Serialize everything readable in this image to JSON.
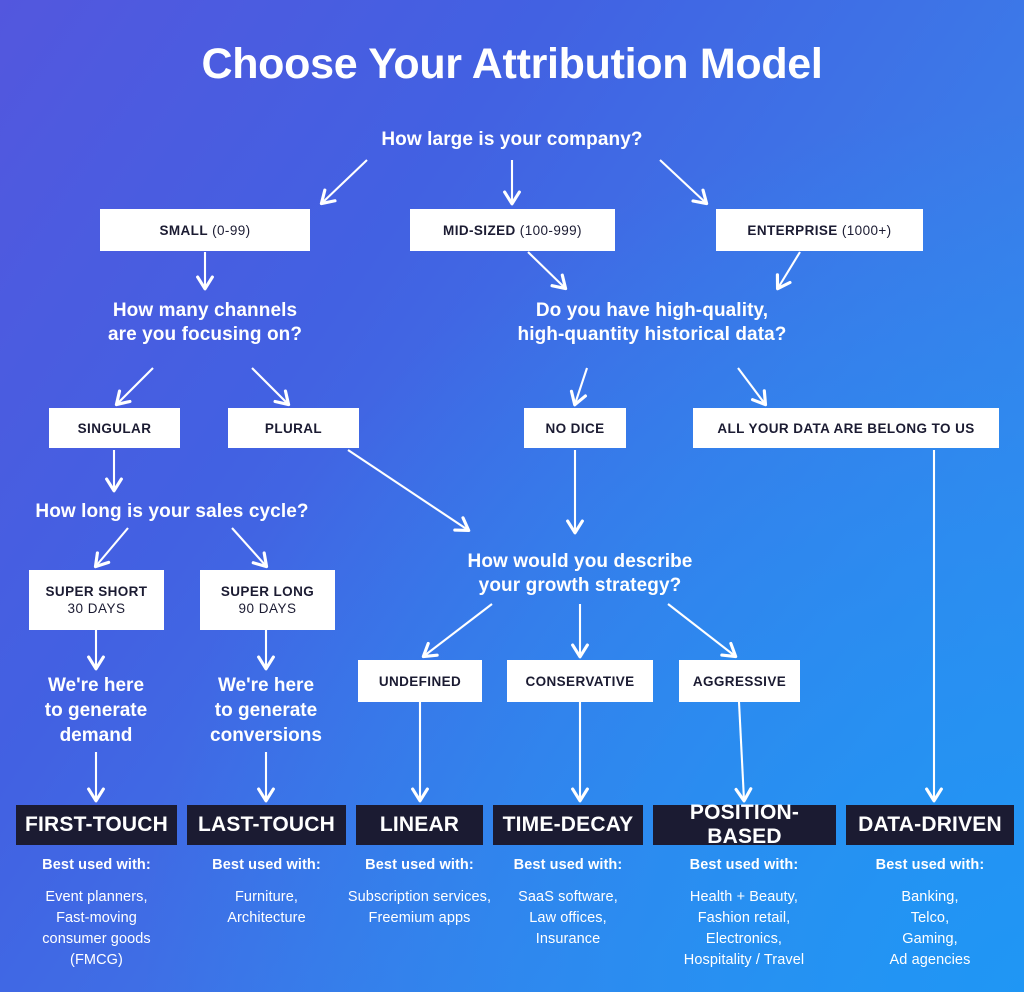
{
  "title": "Choose Your Attribution Model",
  "colors": {
    "bg_start": "#5357de",
    "bg_end": "#3391ef",
    "box_fill": "#ffffff",
    "box_text": "#1b1b32",
    "model_box_fill": "#1b1b32",
    "text_on_bg": "#ffffff"
  },
  "questions": {
    "q_company_size": "How large is your company?",
    "q_channels_line1": "How many channels",
    "q_channels_line2": "are you focusing on?",
    "q_data_line1": "Do you have high-quality,",
    "q_data_line2": "high-quantity historical data?",
    "q_sales_cycle": "How long is your sales cycle?",
    "q_growth_line1": "How would you describe",
    "q_growth_line2": "your growth strategy?"
  },
  "size_boxes": [
    {
      "bold": "SMALL",
      "rest": " (0-99)"
    },
    {
      "bold": "MID-SIZED",
      "rest": " (100-999)"
    },
    {
      "bold": "ENTERPRISE",
      "rest": " (1000+)"
    }
  ],
  "channel_boxes": [
    {
      "bold": "SINGULAR",
      "rest": ""
    },
    {
      "bold": "PLURAL",
      "rest": ""
    }
  ],
  "data_boxes": [
    {
      "bold": "NO DICE",
      "rest": ""
    },
    {
      "bold": "ALL YOUR DATA ARE BELONG TO US",
      "rest": ""
    }
  ],
  "cycle_boxes": [
    {
      "bold": "SUPER SHORT",
      "line2": "30 DAYS"
    },
    {
      "bold": "SUPER LONG",
      "line2": "90 DAYS"
    }
  ],
  "outcomes": [
    {
      "line1": "We're here",
      "line2": "to generate",
      "line3": "demand"
    },
    {
      "line1": "We're here",
      "line2": "to generate",
      "line3": "conversions"
    }
  ],
  "growth_boxes": [
    {
      "bold": "UNDEFINED",
      "rest": ""
    },
    {
      "bold": "CONSERVATIVE",
      "rest": ""
    },
    {
      "bold": "AGGRESSIVE",
      "rest": ""
    }
  ],
  "models": [
    {
      "name": "FIRST-TOUCH",
      "footer_heading": "Best used with:",
      "footer_lines": [
        "Event planners,",
        "Fast-moving",
        "consumer goods",
        "(FMCG)"
      ]
    },
    {
      "name": "LAST-TOUCH",
      "footer_heading": "Best used with:",
      "footer_lines": [
        "Furniture,",
        "Architecture"
      ]
    },
    {
      "name": "LINEAR",
      "footer_heading": "Best used with:",
      "footer_lines": [
        "Subscription services,",
        "Freemium apps"
      ]
    },
    {
      "name": "TIME-DECAY",
      "footer_heading": "Best used with:",
      "footer_lines": [
        "SaaS software,",
        "Law offices,",
        "Insurance"
      ]
    },
    {
      "name": "POSITION-BASED",
      "footer_heading": "Best used with:",
      "footer_lines": [
        "Health + Beauty,",
        "Fashion retail,",
        "Electronics,",
        "Hospitality / Travel"
      ]
    },
    {
      "name": "DATA-DRIVEN",
      "footer_heading": "Best used with:",
      "footer_lines": [
        "Banking,",
        "Telco,",
        "Gaming,",
        "Ad agencies"
      ]
    }
  ]
}
